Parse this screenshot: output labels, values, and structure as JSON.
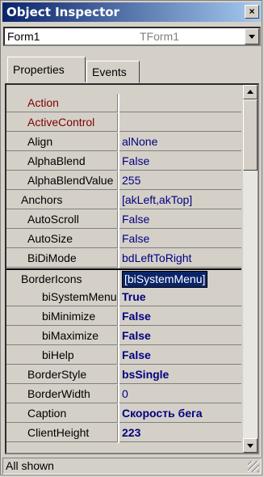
{
  "window": {
    "title": "Object Inspector",
    "close_label": "×"
  },
  "object_selector": {
    "name": "Form1",
    "class": "TForm1"
  },
  "tabs": [
    {
      "label": "Properties"
    },
    {
      "label": "Events"
    }
  ],
  "properties": [
    {
      "name": "Action",
      "value": ""
    },
    {
      "name": "ActiveControl",
      "value": ""
    },
    {
      "name": "Align",
      "value": "alNone"
    },
    {
      "name": "AlphaBlend",
      "value": "False"
    },
    {
      "name": "AlphaBlendValue",
      "value": "255"
    },
    {
      "name": "Anchors",
      "value": "[akLeft,akTop]"
    },
    {
      "name": "AutoScroll",
      "value": "False"
    },
    {
      "name": "AutoSize",
      "value": "False"
    },
    {
      "name": "BiDiMode",
      "value": "bdLeftToRight"
    },
    {
      "name": "BorderIcons",
      "value": "[biSystemMenu]"
    },
    {
      "name": "biSystemMenu",
      "value": "True"
    },
    {
      "name": "biMinimize",
      "value": "False"
    },
    {
      "name": "biMaximize",
      "value": "False"
    },
    {
      "name": "biHelp",
      "value": "False"
    },
    {
      "name": "BorderStyle",
      "value": "bsSingle"
    },
    {
      "name": "BorderWidth",
      "value": "0"
    },
    {
      "name": "Caption",
      "value": "Скорость бега"
    },
    {
      "name": "ClientHeight",
      "value": "223"
    }
  ],
  "status": {
    "text": "All shown"
  },
  "colors": {
    "title_start": "#0a246a",
    "title_end": "#a6caf0",
    "value_text": "#000080",
    "event_name": "#800000"
  }
}
